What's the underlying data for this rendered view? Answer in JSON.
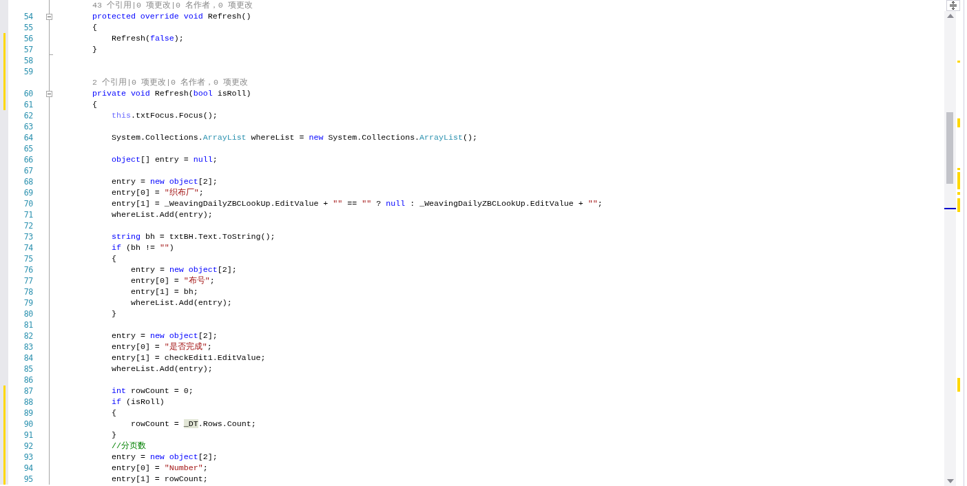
{
  "lines": [
    {
      "kind": "lens",
      "changed": false,
      "text": "43 个引用|0 项更改|0 名作者，0 项更改"
    },
    {
      "kind": "code",
      "number": "54",
      "changed": false,
      "expanded": true,
      "tokens": [
        {
          "kind": "keyword",
          "text": "protected override void"
        },
        {
          "kind": "plain",
          "text": " Refresh()"
        }
      ]
    },
    {
      "kind": "code",
      "number": "55",
      "changed": false,
      "tokens": [
        {
          "kind": "plain",
          "text": "{"
        }
      ],
      "children": [
        {
          "kind": "code",
          "number": "56",
          "changed": true,
          "tokens": [
            {
              "kind": "plain",
              "text": "Refresh("
            },
            {
              "kind": "keyword",
              "text": "false"
            },
            {
              "kind": "plain",
              "text": ");"
            }
          ]
        }
      ]
    },
    {
      "kind": "code",
      "number": "57",
      "changed": true,
      "fold_end": true,
      "tokens": [
        {
          "kind": "plain",
          "text": "}"
        }
      ]
    },
    {
      "kind": "code",
      "number": "58",
      "changed": true
    },
    {
      "kind": "code",
      "number": "59",
      "changed": true
    },
    {
      "kind": "lens",
      "changed": true,
      "text": "2 个引用|0 项更改|0 名作者，0 项更改"
    },
    {
      "kind": "code",
      "number": "60",
      "changed": true,
      "expanded": true,
      "tokens": [
        {
          "kind": "keyword",
          "text": "private void"
        },
        {
          "kind": "plain",
          "text": " Refresh("
        },
        {
          "kind": "keyword",
          "text": "bool"
        },
        {
          "kind": "plain",
          "text": " isRoll)"
        }
      ]
    },
    {
      "kind": "code",
      "number": "61",
      "changed": true,
      "tokens": [
        {
          "kind": "plain",
          "text": "{"
        }
      ],
      "children": [
        {
          "kind": "code",
          "number": "62",
          "changed": false,
          "tokens": [
            {
              "kind": "self",
              "text": "this"
            },
            {
              "kind": "plain",
              "text": ".txtFocus.Focus();"
            }
          ]
        },
        {
          "kind": "code",
          "number": "63",
          "changed": false
        },
        {
          "kind": "code",
          "number": "64",
          "changed": false,
          "tokens": [
            {
              "kind": "plain",
              "text": "System.Collections."
            },
            {
              "kind": "type",
              "text": "ArrayList"
            },
            {
              "kind": "plain",
              "text": " whereList = "
            },
            {
              "kind": "keyword",
              "text": "new"
            },
            {
              "kind": "plain",
              "text": " System.Collections."
            },
            {
              "kind": "type",
              "text": "ArrayList"
            },
            {
              "kind": "plain",
              "text": "();"
            }
          ]
        },
        {
          "kind": "code",
          "number": "65",
          "changed": false
        },
        {
          "kind": "code",
          "number": "66",
          "changed": false,
          "tokens": [
            {
              "kind": "keyword",
              "text": "object"
            },
            {
              "kind": "plain",
              "text": "[] entry = "
            },
            {
              "kind": "keyword",
              "text": "null"
            },
            {
              "kind": "plain",
              "text": ";"
            }
          ]
        },
        {
          "kind": "code",
          "number": "67",
          "changed": false
        },
        {
          "kind": "code",
          "number": "68",
          "changed": false,
          "tokens": [
            {
              "kind": "plain",
              "text": "entry = "
            },
            {
              "kind": "keyword",
              "text": "new object"
            },
            {
              "kind": "plain",
              "text": "[2];"
            }
          ]
        },
        {
          "kind": "code",
          "number": "69",
          "changed": false,
          "tokens": [
            {
              "kind": "plain",
              "text": "entry[0] = "
            },
            {
              "kind": "string",
              "text": "\"织布厂\""
            },
            {
              "kind": "plain",
              "text": ";"
            }
          ]
        },
        {
          "kind": "code",
          "number": "70",
          "changed": false,
          "tokens": [
            {
              "kind": "plain",
              "text": "entry[1] = _WeavingDailyZBCLookUp.EditValue + "
            },
            {
              "kind": "string",
              "text": "\"\""
            },
            {
              "kind": "plain",
              "text": " == "
            },
            {
              "kind": "string",
              "text": "\"\""
            },
            {
              "kind": "plain",
              "text": " ? "
            },
            {
              "kind": "keyword",
              "text": "null"
            },
            {
              "kind": "plain",
              "text": " : _WeavingDailyZBCLookUp.EditValue + "
            },
            {
              "kind": "string",
              "text": "\"\""
            },
            {
              "kind": "plain",
              "text": ";"
            }
          ]
        },
        {
          "kind": "code",
          "number": "71",
          "changed": false,
          "tokens": [
            {
              "kind": "plain",
              "text": "whereList.Add(entry);"
            }
          ]
        },
        {
          "kind": "code",
          "number": "72",
          "changed": false
        },
        {
          "kind": "code",
          "number": "73",
          "changed": false,
          "tokens": [
            {
              "kind": "keyword",
              "text": "string"
            },
            {
              "kind": "plain",
              "text": " bh = txtBH.Text.ToString();"
            }
          ]
        },
        {
          "kind": "code",
          "number": "74",
          "changed": false,
          "tokens": [
            {
              "kind": "keyword",
              "text": "if"
            },
            {
              "kind": "plain",
              "text": " (bh != "
            },
            {
              "kind": "string",
              "text": "\"\""
            },
            {
              "kind": "plain",
              "text": ")"
            }
          ]
        },
        {
          "kind": "code",
          "number": "75",
          "changed": false,
          "tokens": [
            {
              "kind": "plain",
              "text": "{"
            }
          ],
          "children": [
            {
              "kind": "code",
              "number": "76",
              "changed": false,
              "tokens": [
                {
                  "kind": "plain",
                  "text": "entry = "
                },
                {
                  "kind": "keyword",
                  "text": "new object"
                },
                {
                  "kind": "plain",
                  "text": "[2];"
                }
              ]
            },
            {
              "kind": "code",
              "number": "77",
              "changed": false,
              "tokens": [
                {
                  "kind": "plain",
                  "text": "entry[0] = "
                },
                {
                  "kind": "string",
                  "text": "\"布号\""
                },
                {
                  "kind": "plain",
                  "text": ";"
                }
              ]
            },
            {
              "kind": "code",
              "number": "78",
              "changed": false,
              "tokens": [
                {
                  "kind": "plain",
                  "text": "entry[1] = bh;"
                }
              ]
            },
            {
              "kind": "code",
              "number": "79",
              "changed": false,
              "tokens": [
                {
                  "kind": "plain",
                  "text": "whereList.Add(entry);"
                }
              ]
            }
          ]
        },
        {
          "kind": "code",
          "number": "80",
          "changed": false,
          "tokens": [
            {
              "kind": "plain",
              "text": "}"
            }
          ]
        },
        {
          "kind": "code",
          "number": "81",
          "changed": false
        },
        {
          "kind": "code",
          "number": "82",
          "changed": false,
          "tokens": [
            {
              "kind": "plain",
              "text": "entry = "
            },
            {
              "kind": "keyword",
              "text": "new object"
            },
            {
              "kind": "plain",
              "text": "[2];"
            }
          ]
        },
        {
          "kind": "code",
          "number": "83",
          "changed": false,
          "tokens": [
            {
              "kind": "plain",
              "text": "entry[0] = "
            },
            {
              "kind": "string",
              "text": "\"是否完成\""
            },
            {
              "kind": "plain",
              "text": ";"
            }
          ]
        },
        {
          "kind": "code",
          "number": "84",
          "changed": false,
          "tokens": [
            {
              "kind": "plain",
              "text": "entry[1] = checkEdit1.EditValue;"
            }
          ]
        },
        {
          "kind": "code",
          "number": "85",
          "changed": false,
          "tokens": [
            {
              "kind": "plain",
              "text": "whereList.Add(entry);"
            }
          ]
        },
        {
          "kind": "code",
          "number": "86",
          "changed": false
        },
        {
          "kind": "code",
          "number": "87",
          "changed": true,
          "tokens": [
            {
              "kind": "keyword",
              "text": "int"
            },
            {
              "kind": "plain",
              "text": " rowCount = 0;"
            }
          ]
        },
        {
          "kind": "code",
          "number": "88",
          "changed": true,
          "tokens": [
            {
              "kind": "keyword",
              "text": "if"
            },
            {
              "kind": "plain",
              "text": " (isRoll)"
            }
          ]
        },
        {
          "kind": "code",
          "number": "89",
          "changed": true,
          "tokens": [
            {
              "kind": "plain",
              "text": "{"
            }
          ],
          "children": [
            {
              "kind": "code",
              "number": "90",
              "changed": true,
              "tokens": [
                {
                  "kind": "plain",
                  "text": "rowCount = "
                },
                {
                  "kind": "highlight",
                  "text": "_DT"
                },
                {
                  "kind": "plain",
                  "text": ".Rows.Count;"
                }
              ]
            }
          ]
        },
        {
          "kind": "code",
          "number": "91",
          "changed": true,
          "tokens": [
            {
              "kind": "plain",
              "text": "}"
            }
          ]
        },
        {
          "kind": "code",
          "number": "92",
          "changed": true,
          "tokens": [
            {
              "kind": "comment",
              "text": "//分页数"
            }
          ]
        },
        {
          "kind": "code",
          "number": "93",
          "changed": true,
          "tokens": [
            {
              "kind": "plain",
              "text": "entry = "
            },
            {
              "kind": "keyword",
              "text": "new object"
            },
            {
              "kind": "plain",
              "text": "[2];"
            }
          ]
        },
        {
          "kind": "code",
          "number": "94",
          "changed": true,
          "tokens": [
            {
              "kind": "plain",
              "text": "entry[0] = "
            },
            {
              "kind": "string",
              "text": "\"Number\""
            },
            {
              "kind": "plain",
              "text": ";"
            }
          ]
        },
        {
          "kind": "code",
          "number": "95",
          "changed": true,
          "tokens": [
            {
              "kind": "plain",
              "text": "entry[1] = rowCount;"
            }
          ]
        }
      ]
    }
  ]
}
